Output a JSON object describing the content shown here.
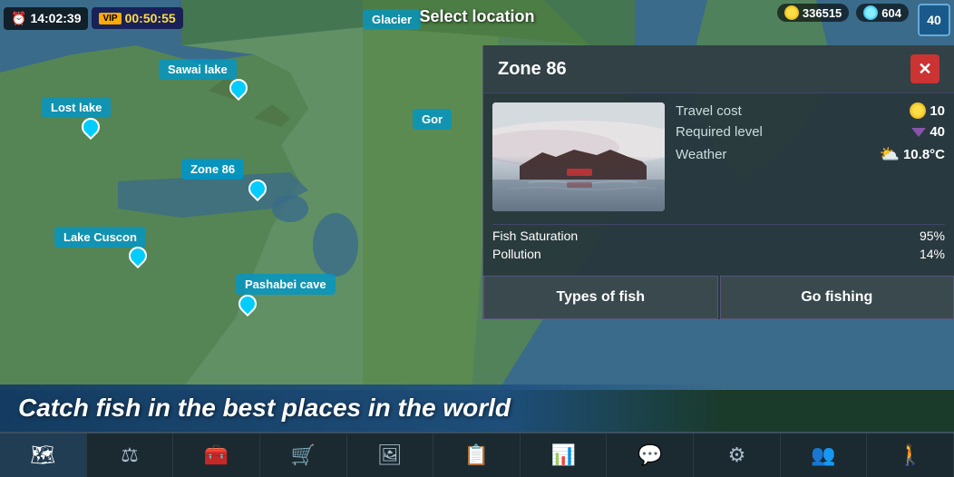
{
  "topbar": {
    "time": "14:02:39",
    "vip_timer": "00:50:55",
    "vip_label": "VIP",
    "select_location": "Select location",
    "coins": "336515",
    "diamonds": "604",
    "level": "40"
  },
  "map_locations": [
    {
      "id": "sawai",
      "label": "Sawai lake",
      "active": false
    },
    {
      "id": "lost",
      "label": "Lost lake",
      "active": false
    },
    {
      "id": "zone86",
      "label": "Zone 86",
      "active": true
    },
    {
      "id": "cuscon",
      "label": "Lake Cuscon",
      "active": false
    },
    {
      "id": "pashabei",
      "label": "Pashabei cave",
      "active": false
    },
    {
      "id": "gor",
      "label": "Gor",
      "active": false
    },
    {
      "id": "glacier",
      "label": "Glacier",
      "active": false
    }
  ],
  "panel": {
    "title": "Zone 86",
    "close_label": "✕",
    "travel_cost_label": "Travel cost",
    "travel_cost_value": "10",
    "required_level_label": "Required level",
    "required_level_value": "40",
    "weather_label": "Weather",
    "weather_value": "10.8°C",
    "fish_saturation_label": "Fish Saturation",
    "fish_saturation_value": "95%",
    "pollution_label": "Pollution",
    "pollution_value": "14%",
    "types_of_fish_btn": "Types of fish",
    "go_fishing_btn": "Go fishing"
  },
  "banner": {
    "text": "Catch fish in the best places in the world"
  },
  "navbar": {
    "items": [
      {
        "id": "location",
        "icon": "🗺",
        "active": true
      },
      {
        "id": "balance",
        "icon": "⚖",
        "active": false
      },
      {
        "id": "equipment",
        "icon": "🧰",
        "active": false
      },
      {
        "id": "shop",
        "icon": "🛒",
        "active": false
      },
      {
        "id": "gallery",
        "icon": "🖼",
        "active": false
      },
      {
        "id": "tasks",
        "icon": "📋",
        "active": false
      },
      {
        "id": "stats",
        "icon": "📊",
        "active": false
      },
      {
        "id": "chat",
        "icon": "💬",
        "active": false
      },
      {
        "id": "settings",
        "icon": "⚙",
        "active": false
      },
      {
        "id": "friends",
        "icon": "👥",
        "active": false
      },
      {
        "id": "exit",
        "icon": "🚪",
        "active": false
      }
    ]
  }
}
